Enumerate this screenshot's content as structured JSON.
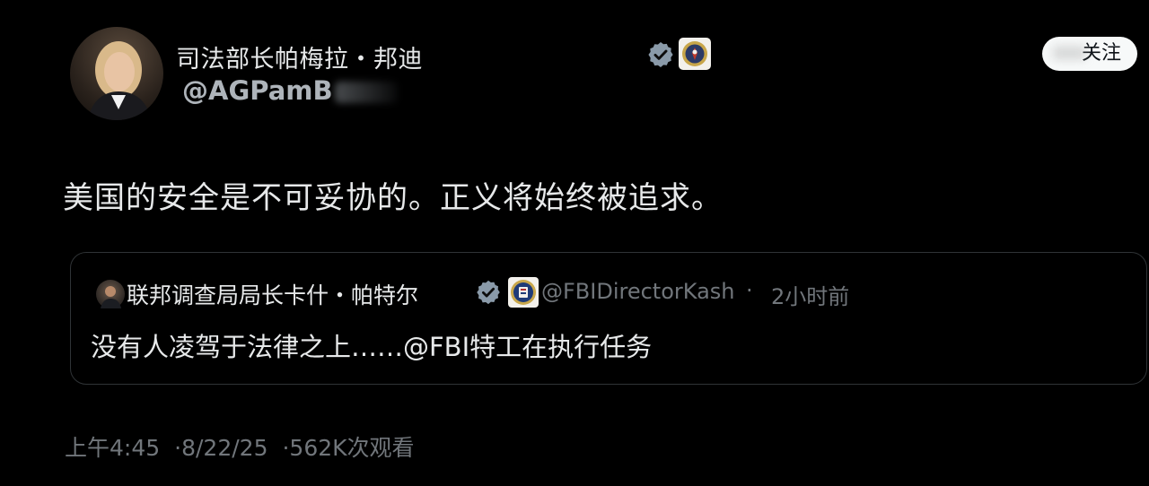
{
  "author": {
    "display_name": "司法部长帕梅拉・邦迪",
    "handle": "@AGPamB",
    "verified_icon": "verified-badge-icon",
    "affiliation_icon": "doj-seal-icon",
    "follow_label": "关注"
  },
  "tweet": {
    "text": "美国的安全是不可妥协的。正义将始终被追求。"
  },
  "quoted": {
    "display_name": "联邦调查局局长卡什・帕特尔",
    "handle": "@FBIDirectorKash",
    "separator": "·",
    "time": "2小时前",
    "text": "没有人凌驾于法律之上……@FBI特工在执行任务",
    "verified_icon": "verified-badge-icon",
    "affiliation_icon": "fbi-seal-icon"
  },
  "meta": {
    "time": "上午4:45",
    "date": "8/22/25",
    "views": "562K次观看",
    "separator": "·"
  },
  "colors": {
    "background": "#000000",
    "text_primary": "#e7e9ea",
    "text_secondary": "#71767b",
    "verified": "#8a9aa9",
    "card_border": "#2f3336"
  }
}
